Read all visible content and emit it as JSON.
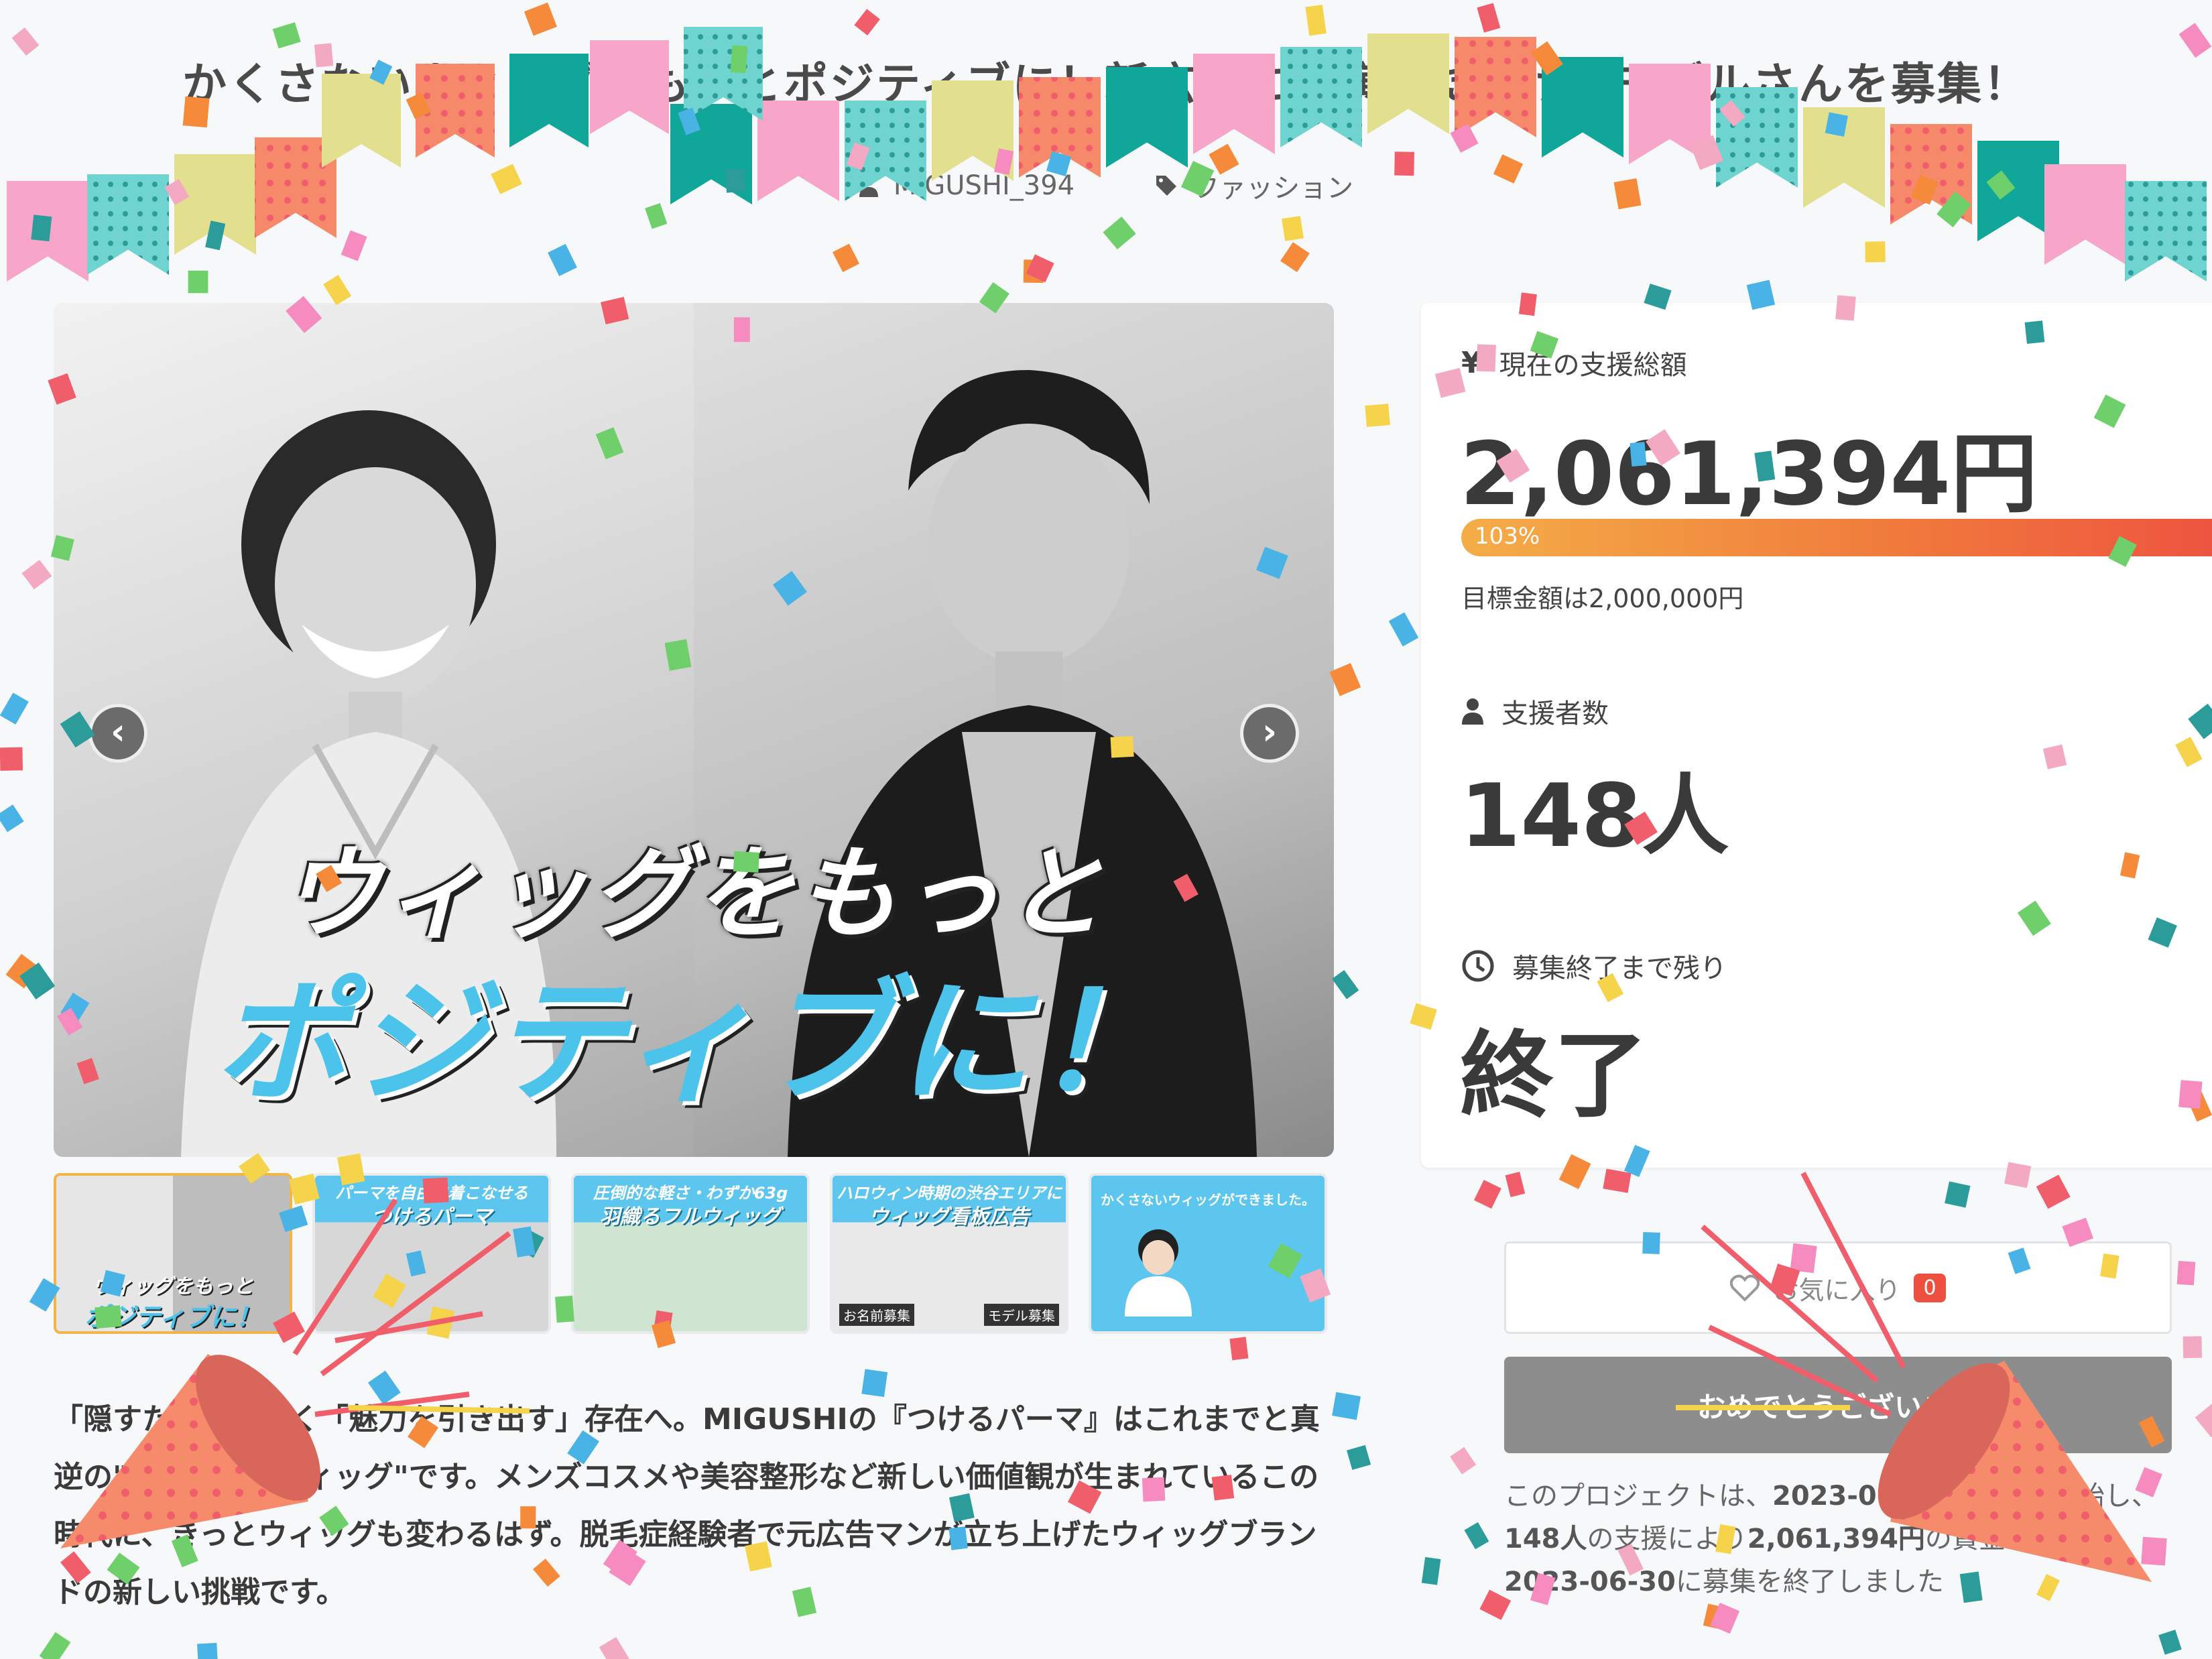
{
  "header": {
    "title": "かくさないウィッグをもっとポジティブに！新広告に出演いただけるモデルさんを募集！",
    "owner": "MIGUSHI_394",
    "category": "ファッション"
  },
  "hero": {
    "line1": "ウィッグをもっと",
    "line2": "ポジティブに！"
  },
  "thumbnails": [
    {
      "caption": "ウィッグをもっと",
      "caption2": "ポジティブに！"
    },
    {
      "caption": "パーマを自由に着こなせる",
      "caption2": "つけるパーマ"
    },
    {
      "caption": "圧倒的な軽さ・わずか63g",
      "caption2": "羽織るフルウィッグ"
    },
    {
      "caption": "ハロウィン時期の渋谷エリアに",
      "caption2": "ウィッグ看板広告",
      "tag1": "お名前募集",
      "tag2": "モデル募集"
    },
    {
      "caption": "かくさないウィッグができました。"
    }
  ],
  "description": "「隠すためではなく「魅力を引き出す」存在へ。MIGUSHIの『つけるパーマ』はこれまでと真逆の\"かくさないウィッグ\"です。メンズコスメや美容整形など新しい価値観が生まれているこの時代に、きっとウィッグも変わるはず。脱毛症経験者で元広告マンが立ち上げたウィッグブランドの新しい挑戦です。",
  "stats": {
    "total_label": "現在の支援総額",
    "total_value": "2,061,394円",
    "progress_percent": 103,
    "progress_label": "103%",
    "goal_text": "目標金額は2,000,000円",
    "supporters_label": "支援者数",
    "supporters_value": "148人",
    "remaining_label": "募集終了まで残り",
    "remaining_value": "終了"
  },
  "actions": {
    "favorite_label": "お気に入り",
    "favorite_count": "0",
    "congrats_label": "おめでとうございます"
  },
  "end_note": {
    "prefix": "このプロジェクトは、",
    "start_date": "2023-06-01",
    "mid1": "に募集を開始し、",
    "supporters": "148人",
    "mid2": "の支援により",
    "amount": "2,061,394円",
    "mid3": "の資金を集め、",
    "end_date": "2023-06-30",
    "suffix": "に募集を終了しました"
  },
  "colors": {
    "accent_orange": "#f07a3c",
    "progress_start": "#f4ad47",
    "progress_end": "#ee5040",
    "hero_blue": "#4cc3ea",
    "button_gray": "#8d8d8d"
  },
  "icons": {
    "owner": "user-icon",
    "category": "tag-icon",
    "total": "yen-icon",
    "supporters": "person-icon",
    "remaining": "clock-icon",
    "favorite": "heart-icon"
  }
}
